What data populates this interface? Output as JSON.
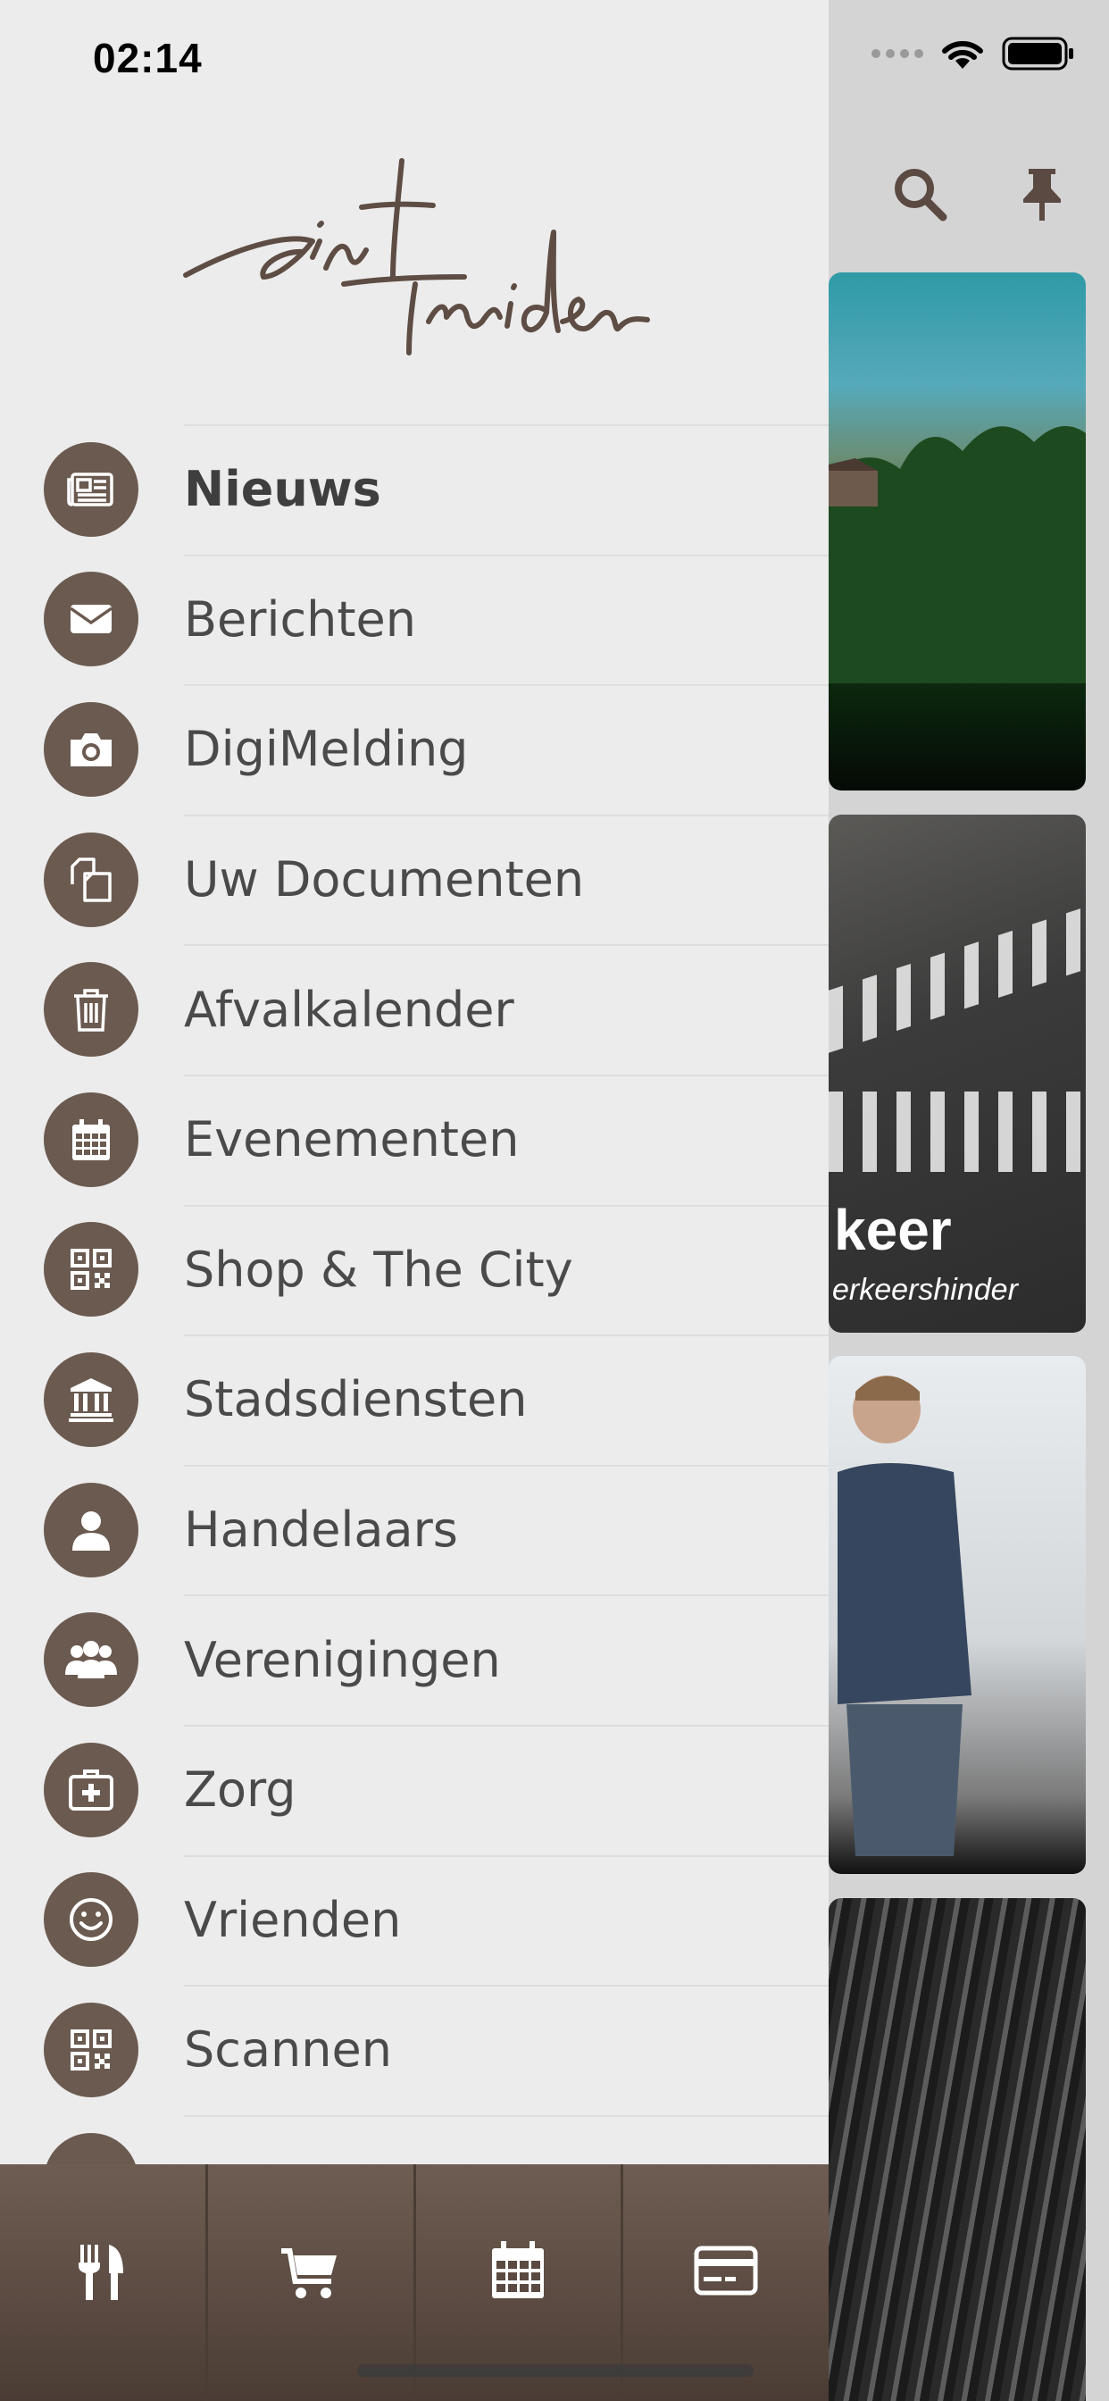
{
  "status_bar": {
    "time": "02:14"
  },
  "logo": {
    "text": "Sint Truiden"
  },
  "menu": {
    "items": [
      {
        "label": "Nieuws",
        "icon": "newspaper-icon",
        "active": true
      },
      {
        "label": "Berichten",
        "icon": "envelope-icon"
      },
      {
        "label": "DigiMelding",
        "icon": "camera-icon"
      },
      {
        "label": "Uw Documenten",
        "icon": "documents-icon"
      },
      {
        "label": "Afvalkalender",
        "icon": "trash-icon"
      },
      {
        "label": "Evenementen",
        "icon": "calendar-icon"
      },
      {
        "label": "Shop & The City",
        "icon": "qr-code-icon"
      },
      {
        "label": "Stadsdiensten",
        "icon": "institution-icon"
      },
      {
        "label": "Handelaars",
        "icon": "user-icon"
      },
      {
        "label": "Verenigingen",
        "icon": "group-icon"
      },
      {
        "label": "Zorg",
        "icon": "medical-kit-icon"
      },
      {
        "label": "Vrienden",
        "icon": "smiley-icon"
      },
      {
        "label": "Scannen",
        "icon": "qr-code-icon"
      }
    ]
  },
  "bottom_bar": {
    "buttons": [
      {
        "icon": "fork-knife-icon"
      },
      {
        "icon": "shopping-cart-icon"
      },
      {
        "icon": "calendar-icon"
      },
      {
        "icon": "credit-card-icon"
      }
    ]
  },
  "background": {
    "card2_title": "keer",
    "card2_subtitle": "erkeershinder"
  },
  "colors": {
    "accent": "#6b5a50",
    "drawer_bg": "#ececec",
    "text": "#4a4a4a"
  }
}
